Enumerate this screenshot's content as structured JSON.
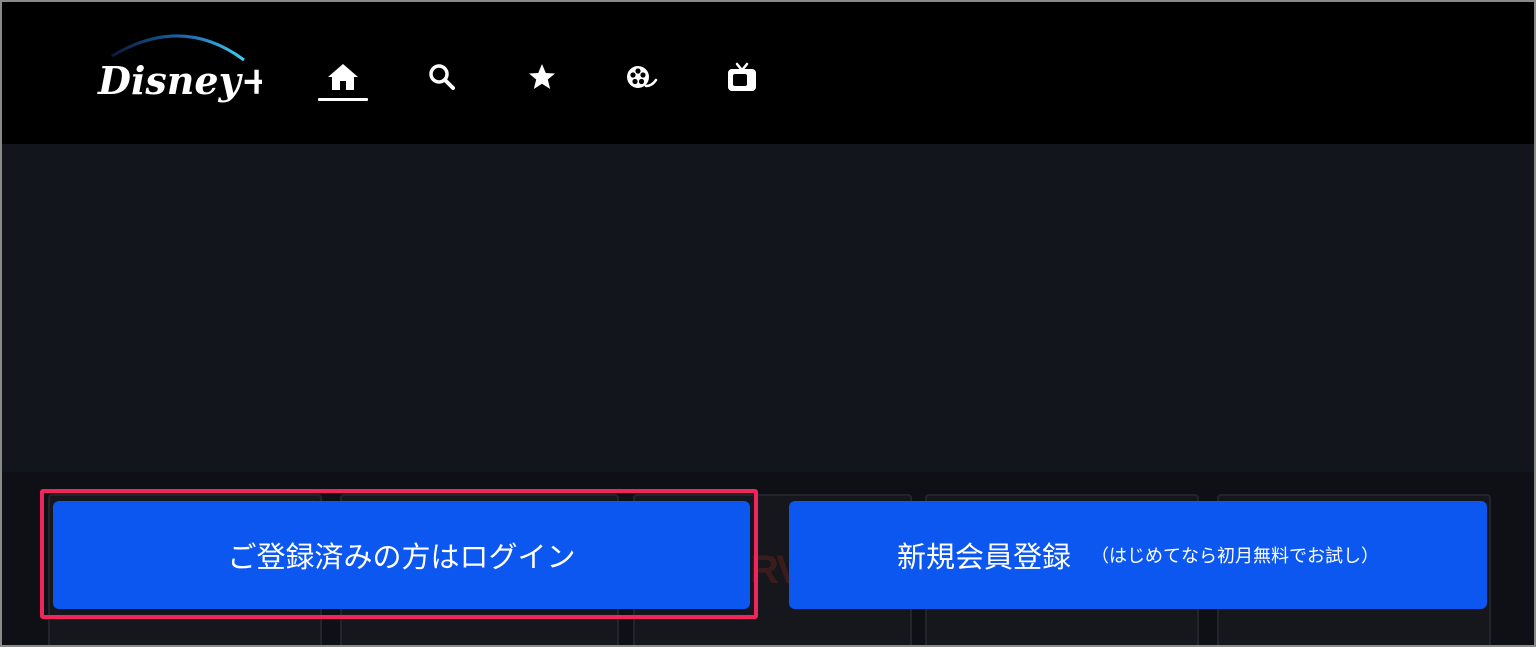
{
  "header": {
    "logo_text": "Disney+",
    "nav": [
      {
        "name": "home",
        "icon": "home-icon",
        "active": true
      },
      {
        "name": "search",
        "icon": "search-icon",
        "active": false
      },
      {
        "name": "watchlist",
        "icon": "star-icon",
        "active": false
      },
      {
        "name": "movies",
        "icon": "film-reel-icon",
        "active": false
      },
      {
        "name": "series",
        "icon": "tv-icon",
        "active": false
      }
    ]
  },
  "tiles": {
    "partial_logo_text": "RV"
  },
  "buttons": {
    "login_label": "ご登録済みの方はログイン",
    "signup_label": "新規会員登録",
    "signup_sub": "（はじめてなら初月無料でお試し）"
  },
  "colors": {
    "button_blue": "#0b57f0",
    "highlight_pink": "#f0255e",
    "header_bg": "#000000",
    "page_bg": "#13151d"
  }
}
